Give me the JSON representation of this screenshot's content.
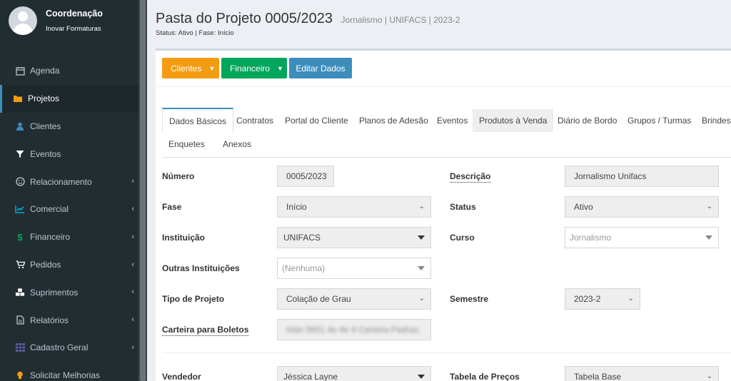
{
  "user": {
    "name": "Coordenação",
    "org": "Inovar Formaturas"
  },
  "menu": [
    {
      "label": "Agenda",
      "icon": "calendar-icon",
      "chevron": false,
      "active": false
    },
    {
      "label": "Projetos",
      "icon": "folder-icon",
      "chevron": false,
      "active": true
    },
    {
      "label": "Clientes",
      "icon": "user-icon",
      "chevron": false,
      "active": false
    },
    {
      "label": "Eventos",
      "icon": "filter-icon",
      "chevron": false,
      "active": false
    },
    {
      "label": "Relacionamento",
      "icon": "smile-icon",
      "chevron": true,
      "active": false
    },
    {
      "label": "Comercial",
      "icon": "chart-line-icon",
      "chevron": true,
      "active": false
    },
    {
      "label": "Financeiro",
      "icon": "dollar-icon",
      "chevron": true,
      "active": false
    },
    {
      "label": "Pedidos",
      "icon": "cart-icon",
      "chevron": true,
      "active": false
    },
    {
      "label": "Suprimentos",
      "icon": "cubes-icon",
      "chevron": true,
      "active": false
    },
    {
      "label": "Relatórios",
      "icon": "file-icon",
      "chevron": true,
      "active": false
    },
    {
      "label": "Cadastro Geral",
      "icon": "grid-icon",
      "chevron": true,
      "active": false
    },
    {
      "label": "Solicitar Melhorias",
      "icon": "lightbulb-icon",
      "chevron": false,
      "active": false
    }
  ],
  "header": {
    "title": "Pasta do Projeto 0005/2023",
    "subtitle": "Jornalismo | UNIFACS | 2023-2",
    "status_line": "Status: Ativo | Fase: Início"
  },
  "buttons": {
    "clientes": "Clientes",
    "financeiro": "Financeiro",
    "editar": "Editar Dados"
  },
  "tabs": {
    "dados_basicos": "Dados Básicos",
    "contratos": "Contratos",
    "portal": "Portal do Cliente",
    "planos": "Planos de Adesão",
    "eventos": "Eventos",
    "produtos": "Produtos à Venda",
    "diario": "Diário de Bordo",
    "grupos": "Grupos / Turmas",
    "brindes": "Brindes",
    "enquetes": "Enquetes",
    "anexos": "Anexos"
  },
  "form": {
    "numero": {
      "label": "Número",
      "value": "0005/2023"
    },
    "descricao": {
      "label": "Descrição",
      "value": "Jornalismo  Unifacs"
    },
    "fase": {
      "label": "Fase",
      "value": "Início"
    },
    "status": {
      "label": "Status",
      "value": "Ativo"
    },
    "instituicao": {
      "label": "Instituição",
      "value": "UNIFACS"
    },
    "curso": {
      "label": "Curso",
      "placeholder": "Jornalismo"
    },
    "outras": {
      "label": "Outras Instituições",
      "placeholder": "(Nenhuma)"
    },
    "tipo": {
      "label": "Tipo de Projeto",
      "value": "Colação de Grau"
    },
    "semestre": {
      "label": "Semestre",
      "value": "2023-2"
    },
    "carteira": {
      "label": "Carteira para Boletos",
      "value": "Inter 0001 4e 4e 4 Carteira Padrao"
    },
    "vendedor": {
      "label": "Vendedor",
      "value": "Jéssica Layne"
    },
    "tabela": {
      "label": "Tabela de Preços",
      "value": "Tabela Base"
    }
  },
  "colors": {
    "sidebar": "#222d32",
    "accent": "#3c8dbc",
    "warning": "#f39c12",
    "success": "#00a65a"
  }
}
